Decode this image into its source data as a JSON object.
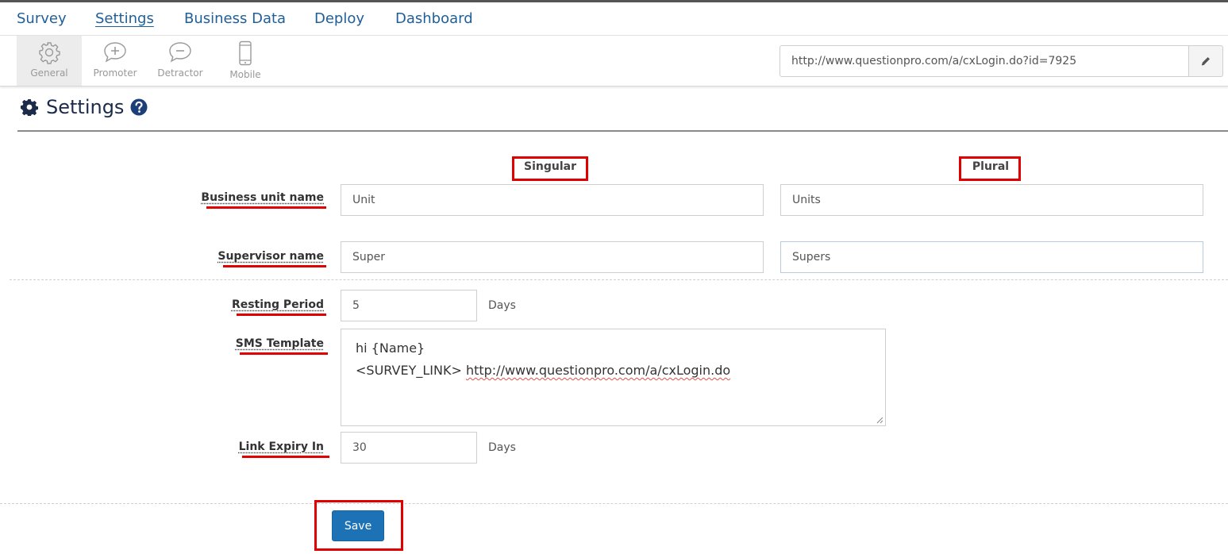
{
  "nav": {
    "tabs": [
      {
        "label": "Survey"
      },
      {
        "label": "Settings",
        "active": true
      },
      {
        "label": "Business Data"
      },
      {
        "label": "Deploy"
      },
      {
        "label": "Dashboard"
      }
    ]
  },
  "subnav": {
    "tabs": [
      {
        "label": "General",
        "icon": "gear-icon",
        "active": true
      },
      {
        "label": "Promoter",
        "icon": "plus-bubble-icon"
      },
      {
        "label": "Detractor",
        "icon": "minus-bubble-icon"
      },
      {
        "label": "Mobile",
        "icon": "mobile-icon"
      }
    ]
  },
  "url_field": {
    "value": "http://www.questionpro.com/a/cxLogin.do?id=7925",
    "edit_icon": "pencil-icon"
  },
  "page": {
    "title": "Settings",
    "title_icon": "gear-icon",
    "help_icon": "question-circle-icon"
  },
  "form": {
    "singular_header": "Singular",
    "plural_header": "Plural",
    "business_unit": {
      "label": "Business unit name",
      "singular": "Unit",
      "plural": "Units"
    },
    "supervisor": {
      "label": "Supervisor name",
      "singular": "Super",
      "plural": "Supers"
    },
    "resting_period": {
      "label": "Resting Period",
      "value": "5",
      "unit": "Days"
    },
    "sms_template": {
      "label": "SMS Template",
      "line1": "hi {Name}",
      "line2_prefix": "<SURVEY_LINK>",
      "line2_link": "http://www.questionpro.com/a/cxLogin.do"
    },
    "link_expiry": {
      "label": "Link Expiry In",
      "value": "30",
      "unit": "Days"
    },
    "save_label": "Save"
  },
  "colors": {
    "nav_link": "#1f5f99",
    "title": "#1c2b4a",
    "highlight": "#e00000",
    "save_button": "#1c72b4"
  }
}
